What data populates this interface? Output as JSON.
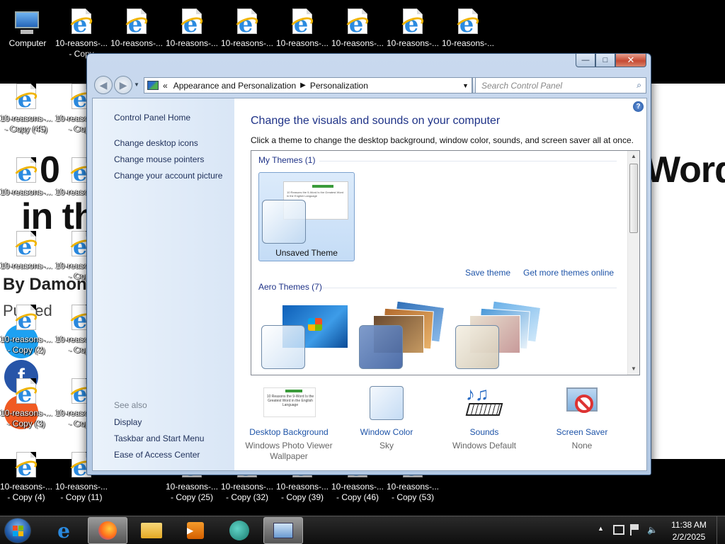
{
  "desktop": {
    "icons_top": [
      {
        "label": "Computer",
        "label2": ""
      },
      {
        "label": "10-reasons-...",
        "label2": "- Copy"
      },
      {
        "label": "10-reasons-...",
        "label2": ""
      },
      {
        "label": "10-reasons-...",
        "label2": ""
      },
      {
        "label": "10-reasons-...",
        "label2": ""
      },
      {
        "label": "10-reasons-...",
        "label2": ""
      },
      {
        "label": "10-reasons-...",
        "label2": ""
      },
      {
        "label": "10-reasons-...",
        "label2": ""
      },
      {
        "label": "10-reasons-...",
        "label2": ""
      }
    ],
    "icons_col1": [
      {
        "label": "10-reasons-...",
        "label2": "- Copy (45)"
      },
      {
        "label": "10-reasons-...",
        "label2": ""
      },
      {
        "label": "10-reasons-...",
        "label2": ""
      },
      {
        "label": "10-reasons-...",
        "label2": "- Copy (2)"
      },
      {
        "label": "10-reasons-...",
        "label2": "- Copy (3)"
      },
      {
        "label": "10-reasons-...",
        "label2": "- Copy (4)"
      }
    ],
    "icons_col2": [
      {
        "label": "10-reasons-...",
        "label2": "- Copy"
      },
      {
        "label": "10-reasons-...",
        "label2": ""
      },
      {
        "label": "10-reasons-...",
        "label2": "- Copy"
      },
      {
        "label": "10-reasons-...",
        "label2": "- Copy"
      },
      {
        "label": "10-reasons-...",
        "label2": "- Copy"
      },
      {
        "label": "10-reasons-...",
        "label2": "- Copy (11)"
      }
    ],
    "icons_bottom": [
      {
        "label": "10-reasons-...",
        "label2": "- Copy (25)"
      },
      {
        "label": "10-reasons-...",
        "label2": "- Copy (32)"
      },
      {
        "label": "10-reasons-...",
        "label2": "- Copy (39)"
      },
      {
        "label": "10-reasons-...",
        "label2": "- Copy (46)"
      },
      {
        "label": "10-reasons-...",
        "label2": "- Copy (53)"
      }
    ],
    "wallpaper": {
      "headline_left_1": "0",
      "headline_right": "Word",
      "headline_left_2": "in th",
      "byline": "By Damon",
      "published": "Pu     hed"
    }
  },
  "window": {
    "caption": {
      "minimize": "—",
      "maximize": "□",
      "close": "✕"
    },
    "address": {
      "chevrons": "«",
      "crumb1": "Appearance and Personalization",
      "sep": "▶",
      "crumb2": "Personalization"
    },
    "search": {
      "placeholder": "Search Control Panel"
    },
    "left_pane": {
      "home": "Control Panel Home",
      "links": [
        "Change desktop icons",
        "Change mouse pointers",
        "Change your account picture"
      ],
      "see_also": "See also",
      "see_also_links": [
        "Display",
        "Taskbar and Start Menu",
        "Ease of Access Center"
      ]
    },
    "main": {
      "title": "Change the visuals and sounds on your computer",
      "subtitle": "Click a theme to change the desktop background, window color, sounds, and screen saver all at once.",
      "my_themes_header": "My Themes (1)",
      "unsaved_theme": "Unsaved Theme",
      "thumb_text": "10 Reasons the 9-Word Is the Greatest Word in the English Language",
      "save_theme": "Save theme",
      "get_more": "Get more themes online",
      "aero_header": "Aero Themes (7)"
    },
    "bottom": [
      {
        "link": "Desktop Background",
        "value": "Windows Photo Viewer Wallpaper",
        "icon": "desktop-background-icon"
      },
      {
        "link": "Window Color",
        "value": "Sky",
        "icon": "window-color-icon"
      },
      {
        "link": "Sounds",
        "value": "Windows Default",
        "icon": "sounds-icon"
      },
      {
        "link": "Screen Saver",
        "value": "None",
        "icon": "screen-saver-icon"
      }
    ]
  },
  "taskbar": {
    "clock_time": "11:38 AM",
    "clock_date": "2/2/2025",
    "tray_arrow": "▲"
  }
}
